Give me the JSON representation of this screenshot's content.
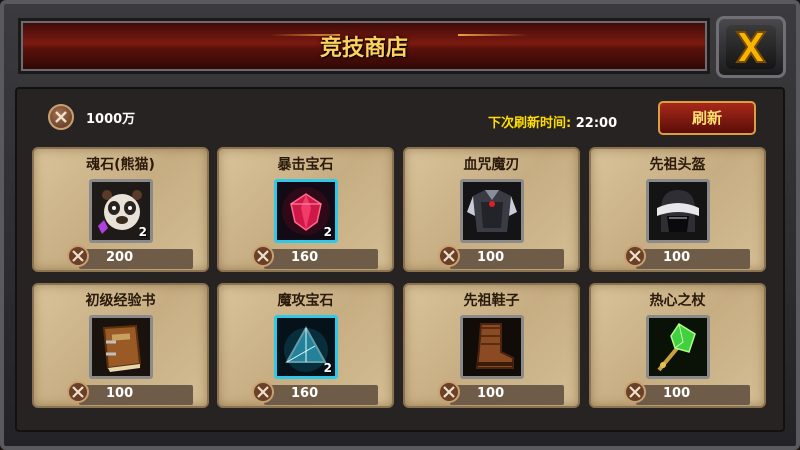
{
  "shop": {
    "title": "竞技商店",
    "currency_amount": "1000万",
    "refresh_label": "下次刷新时间:",
    "refresh_time": "22:00",
    "refresh_button": "刷新"
  },
  "items": [
    {
      "name": "魂石(熊猫)",
      "qty": "2",
      "price": "200",
      "icon": "panda-soulstone-icon",
      "rare": false
    },
    {
      "name": "暴击宝石",
      "qty": "2",
      "price": "160",
      "icon": "ruby-gem-icon",
      "rare": true
    },
    {
      "name": "血咒魔刃",
      "qty": "",
      "price": "100",
      "icon": "dark-armor-icon",
      "rare": false
    },
    {
      "name": "先祖头盔",
      "qty": "",
      "price": "100",
      "icon": "fur-helmet-icon",
      "rare": false
    },
    {
      "name": "初级经验书",
      "qty": "",
      "price": "100",
      "icon": "book-icon",
      "rare": false
    },
    {
      "name": "魔攻宝石",
      "qty": "2",
      "price": "160",
      "icon": "blue-prism-icon",
      "rare": true
    },
    {
      "name": "先祖鞋子",
      "qty": "",
      "price": "100",
      "icon": "leather-boot-icon",
      "rare": false
    },
    {
      "name": "热心之杖",
      "qty": "",
      "price": "100",
      "icon": "green-crystal-staff-icon",
      "rare": false
    }
  ],
  "colors": {
    "title": "#ffd060",
    "refresh_label": "#ffdd00",
    "rare_border": "#30c8e8"
  }
}
